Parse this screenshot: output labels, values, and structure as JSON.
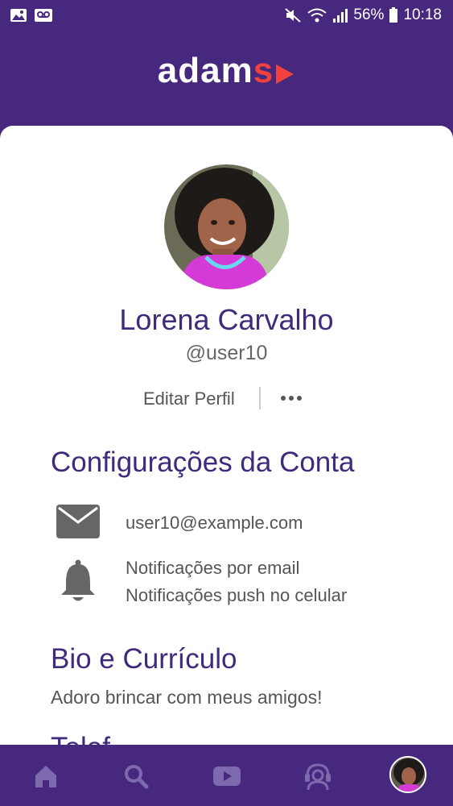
{
  "status_bar": {
    "battery": "56%",
    "time": "10:18"
  },
  "header": {
    "logo_main": "adam",
    "logo_accent": "s"
  },
  "profile": {
    "name": "Lorena Carvalho",
    "handle": "@user10",
    "edit_label": "Editar Perfil"
  },
  "account": {
    "title": "Configurações da Conta",
    "email": "user10@example.com",
    "notifications": [
      "Notificações por email",
      "Notificações push no celular"
    ]
  },
  "bio": {
    "title": "Bio e Currículo",
    "text": "Adoro brincar com meus amigos!"
  },
  "next_section_partial": "Telef",
  "colors": {
    "brand": "#46287e",
    "accent": "#f0413f",
    "title": "#3f2a7c"
  }
}
